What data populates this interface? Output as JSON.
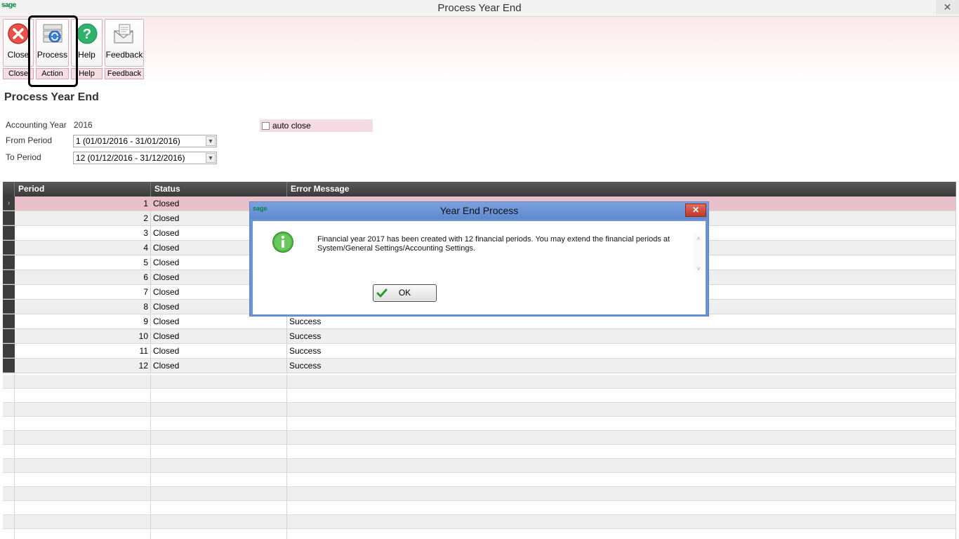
{
  "window": {
    "logo": "sage",
    "title": "Process Year End",
    "close_symbol": "✕"
  },
  "ribbon": {
    "buttons": [
      {
        "label": "Close",
        "icon": "close-icon"
      },
      {
        "label": "Process",
        "icon": "process-icon"
      },
      {
        "label": "Help",
        "icon": "help-icon"
      },
      {
        "label": "Feedback",
        "icon": "feedback-icon"
      }
    ],
    "groups": [
      "Close",
      "Action",
      "Help",
      "Feedback"
    ]
  },
  "form": {
    "heading": "Process Year End",
    "accounting_year_label": "Accounting Year",
    "accounting_year_value": "2016",
    "from_period_label": "From Period",
    "from_period_value": "1 (01/01/2016 - 31/01/2016)",
    "to_period_label": "To Period",
    "to_period_value": "12 (01/12/2016 - 31/12/2016)",
    "auto_close_label": "auto close",
    "auto_close_checked": false
  },
  "grid": {
    "headers": [
      "Period",
      "Status",
      "Error Message"
    ],
    "rows": [
      {
        "period": "1",
        "status": "Closed",
        "message": ""
      },
      {
        "period": "2",
        "status": "Closed",
        "message": ""
      },
      {
        "period": "3",
        "status": "Closed",
        "message": ""
      },
      {
        "period": "4",
        "status": "Closed",
        "message": ""
      },
      {
        "period": "5",
        "status": "Closed",
        "message": ""
      },
      {
        "period": "6",
        "status": "Closed",
        "message": ""
      },
      {
        "period": "7",
        "status": "Closed",
        "message": ""
      },
      {
        "period": "8",
        "status": "Closed",
        "message": ""
      },
      {
        "period": "9",
        "status": "Closed",
        "message": "Success"
      },
      {
        "period": "10",
        "status": "Closed",
        "message": "Success"
      },
      {
        "period": "11",
        "status": "Closed",
        "message": "Success"
      },
      {
        "period": "12",
        "status": "Closed",
        "message": "Success"
      }
    ]
  },
  "dialog": {
    "logo": "sage",
    "title": "Year End Process",
    "message": "Financial year 2017 has been created with 12 financial periods. You may extend the financial periods at System/General Settings/Accounting Settings.",
    "ok_label": "OK",
    "close_symbol": "✕"
  }
}
